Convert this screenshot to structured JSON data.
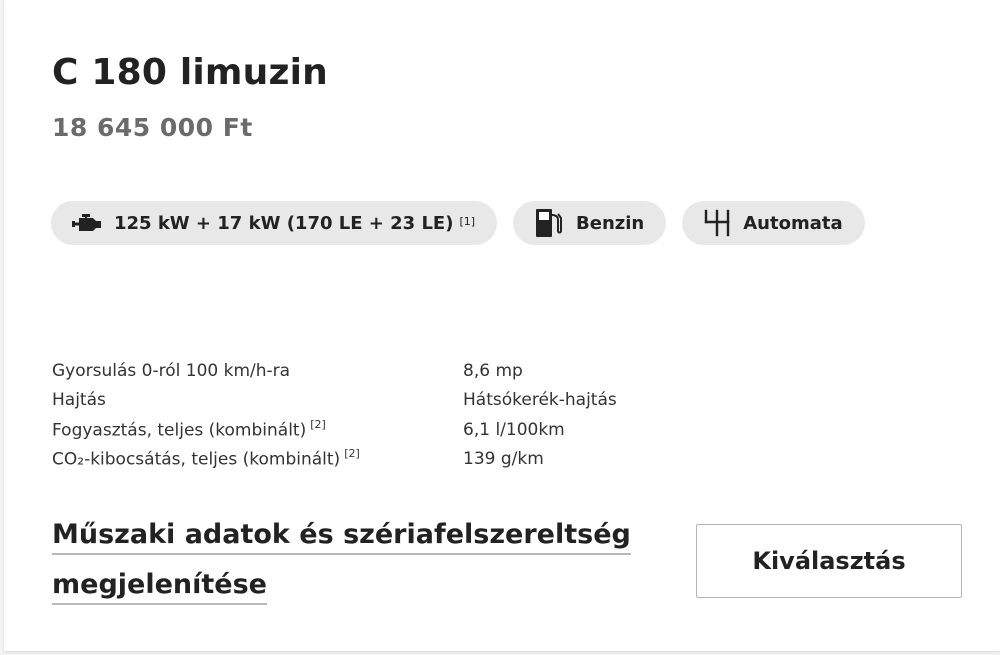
{
  "model": {
    "title": "C 180 limuzin",
    "price": "18 645 000 Ft"
  },
  "chips": [
    {
      "icon": "engine-icon",
      "label": "125 kW + 17 kW (170 LE + 23 LE)",
      "footnote": "[1]"
    },
    {
      "icon": "fuel-pump-icon",
      "label": "Benzin"
    },
    {
      "icon": "gearshift-icon",
      "label": "Automata"
    }
  ],
  "specs": [
    {
      "label": "Gyorsulás 0-ról 100 km/h-ra",
      "footnote": "",
      "value": "8,6 mp"
    },
    {
      "label": "Hajtás",
      "footnote": "",
      "value": "Hátsókerék-hajtás"
    },
    {
      "label": "Fogyasztás, teljes (kombinált)",
      "footnote": "[2]",
      "value": "6,1 l/100km"
    },
    {
      "label": "CO₂-kibocsátás, teljes (kombinált)",
      "footnote": "[2]",
      "value": "139 g/km"
    }
  ],
  "actions": {
    "details_link": "Műszaki adatok és szériafelszereltség megjelenítése",
    "select_button": "Kiválasztás"
  }
}
